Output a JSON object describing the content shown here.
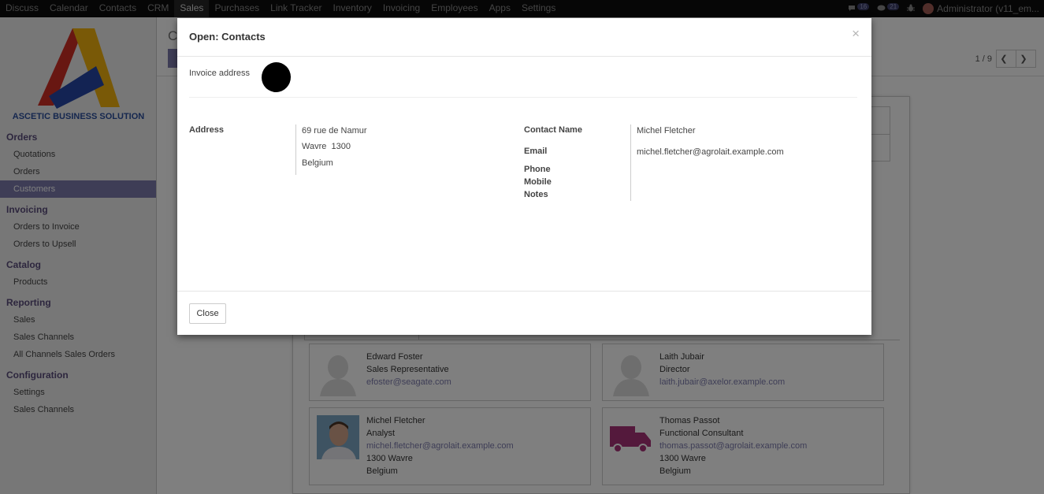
{
  "topbar": {
    "menu": [
      "Discuss",
      "Calendar",
      "Contacts",
      "CRM",
      "Sales",
      "Purchases",
      "Link Tracker",
      "Inventory",
      "Invoicing",
      "Employees",
      "Apps",
      "Settings"
    ],
    "active": "Sales",
    "messages_count": "16",
    "activity_count": "21",
    "user": "Administrator (v11_em..."
  },
  "sidebar": {
    "brand": "ASCETIC BUSINESS SOLUTION",
    "sections": [
      {
        "title": "Orders",
        "items": [
          "Quotations",
          "Orders",
          "Customers"
        ]
      },
      {
        "title": "Invoicing",
        "items": [
          "Orders to Invoice",
          "Orders to Upsell"
        ]
      },
      {
        "title": "Catalog",
        "items": [
          "Products"
        ]
      },
      {
        "title": "Reporting",
        "items": [
          "Sales",
          "Sales Channels",
          "All Channels Sales Orders"
        ]
      },
      {
        "title": "Configuration",
        "items": [
          "Settings",
          "Sales Channels"
        ]
      }
    ],
    "active_item": "Customers"
  },
  "main": {
    "breadcrumb": "C",
    "pager": "1 / 9"
  },
  "contacts": [
    {
      "name": "Edward Foster",
      "role": "Sales Representative",
      "email": "efoster@seagate.com",
      "city": "",
      "country": ""
    },
    {
      "name": "Laith Jubair",
      "role": "Director",
      "email": "laith.jubair@axelor.example.com",
      "city": "",
      "country": ""
    },
    {
      "name": "Michel Fletcher",
      "role": "Analyst",
      "email": "michel.fletcher@agrolait.example.com",
      "city": "1300 Wavre",
      "country": "Belgium"
    },
    {
      "name": "Thomas Passot",
      "role": "Functional Consultant",
      "email": "thomas.passot@agrolait.example.com",
      "city": "1300 Wavre",
      "country": "Belgium"
    }
  ],
  "modal": {
    "title": "Open: Contacts",
    "close_icon": "×",
    "address_type": "Invoice address",
    "labels": {
      "address": "Address",
      "contact_name": "Contact Name",
      "email": "Email",
      "phone": "Phone",
      "mobile": "Mobile",
      "notes": "Notes"
    },
    "address_lines": [
      "69 rue de Namur",
      "Wavre  1300",
      "Belgium"
    ],
    "contact_name": "Michel Fletcher",
    "email": "michel.fletcher@agrolait.example.com",
    "close_button": "Close"
  }
}
